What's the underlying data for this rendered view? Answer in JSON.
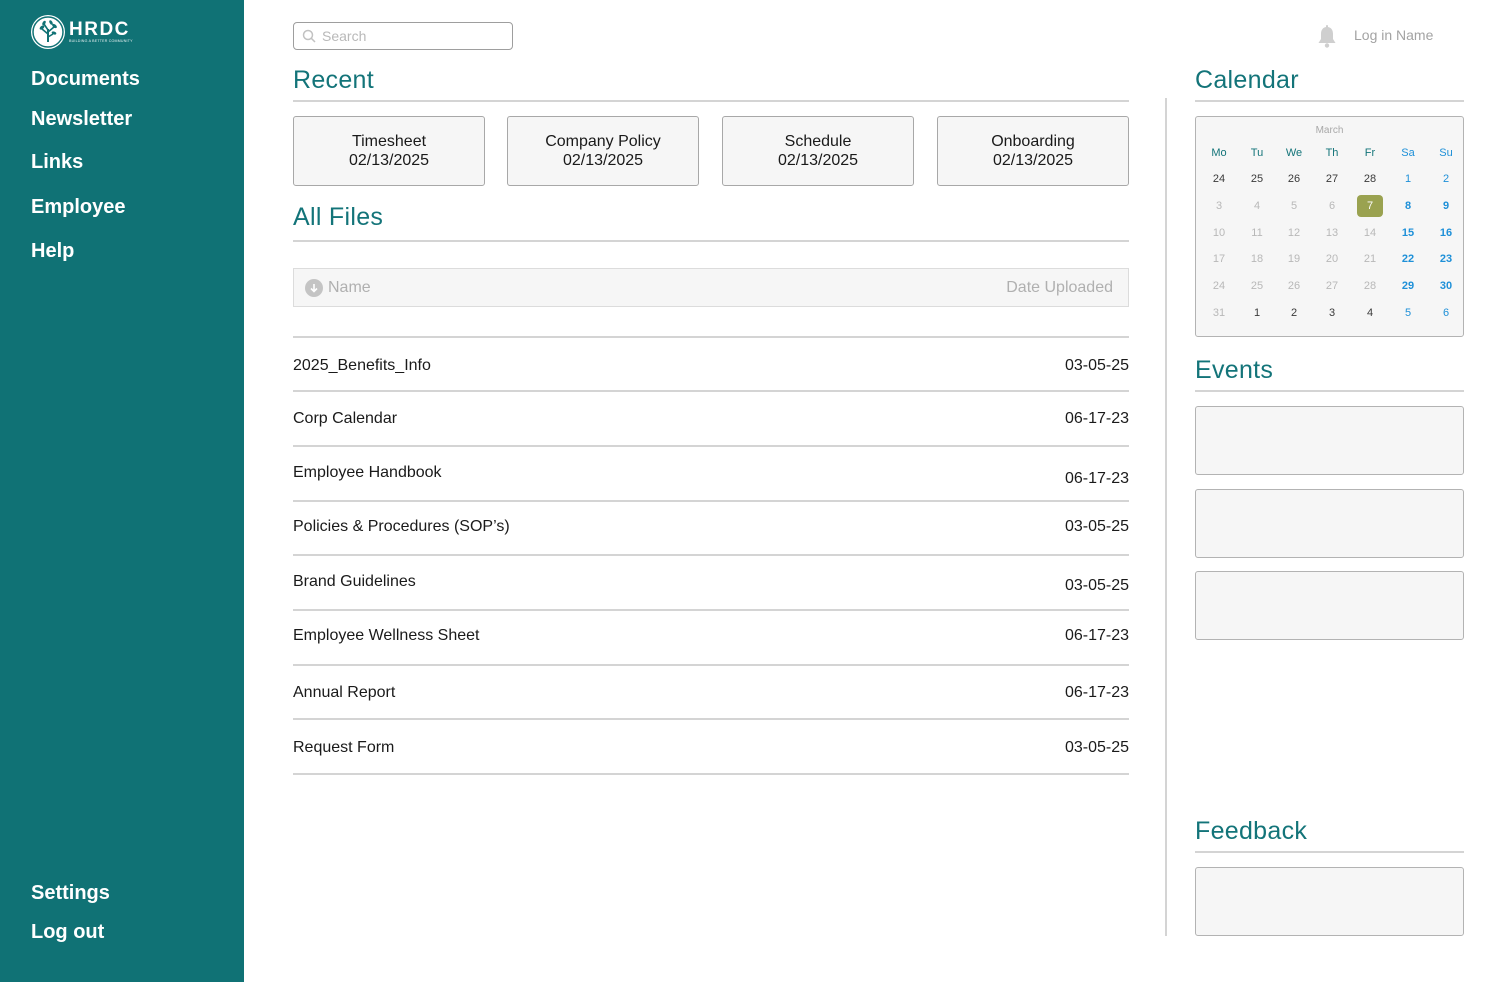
{
  "brand": {
    "name": "HRDC",
    "tagline": "BUILDING A BETTER COMMUNITY",
    "sidebar_color": "#107275",
    "accent_color": "#137479"
  },
  "sidebar": {
    "items": [
      {
        "label": "Documents"
      },
      {
        "label": "Newsletter"
      },
      {
        "label": "Links"
      },
      {
        "label": "Employee"
      },
      {
        "label": "Help"
      }
    ],
    "bottom_items": [
      {
        "label": "Settings"
      },
      {
        "label": "Log out"
      }
    ]
  },
  "topbar": {
    "search_placeholder": "Search",
    "bell_icon": "bell-icon",
    "login_name": "Log in Name"
  },
  "recent": {
    "title": "Recent",
    "cards": [
      {
        "name": "Timesheet",
        "date": "02/13/2025"
      },
      {
        "name": "Company Policy",
        "date": "02/13/2025"
      },
      {
        "name": "Schedule",
        "date": "02/13/2025"
      },
      {
        "name": "Onboarding",
        "date": "02/13/2025"
      }
    ]
  },
  "all_files": {
    "title": "All Files",
    "columns": {
      "name": "Name",
      "date": "Date Uploaded"
    },
    "rows": [
      {
        "name": "2025_Benefits_Info",
        "date": "03-05-25"
      },
      {
        "name": "Corp Calendar",
        "date": "06-17-23"
      },
      {
        "name": "Employee Handbook",
        "date": "06-17-23"
      },
      {
        "name": "Policies & Procedures (SOP’s)",
        "date": "03-05-25"
      },
      {
        "name": "Brand Guidelines",
        "date": "03-05-25"
      },
      {
        "name": "Employee Wellness Sheet",
        "date": "06-17-23"
      },
      {
        "name": "Annual Report",
        "date": "06-17-23"
      },
      {
        "name": "Request Form",
        "date": "03-05-25"
      }
    ]
  },
  "calendar": {
    "title": "Calendar",
    "month": "March",
    "weekdays": [
      "Mo",
      "Tu",
      "We",
      "Th",
      "Fr",
      "Sa",
      "Su"
    ],
    "weeks": [
      [
        "24",
        "25",
        "26",
        "27",
        "28",
        "1",
        "2"
      ],
      [
        "3",
        "4",
        "5",
        "6",
        "7",
        "8",
        "9"
      ],
      [
        "10",
        "11",
        "12",
        "13",
        "14",
        "15",
        "16"
      ],
      [
        "17",
        "18",
        "19",
        "20",
        "21",
        "22",
        "23"
      ],
      [
        "24",
        "25",
        "26",
        "27",
        "28",
        "29",
        "30"
      ],
      [
        "31",
        "1",
        "2",
        "3",
        "4",
        "5",
        "6"
      ]
    ],
    "selected_day": "7",
    "selected_color": "#9aa250",
    "weekday_color": "#137479",
    "weekend_color": "#1e90d8"
  },
  "events": {
    "title": "Events"
  },
  "feedback": {
    "title": "Feedback"
  }
}
